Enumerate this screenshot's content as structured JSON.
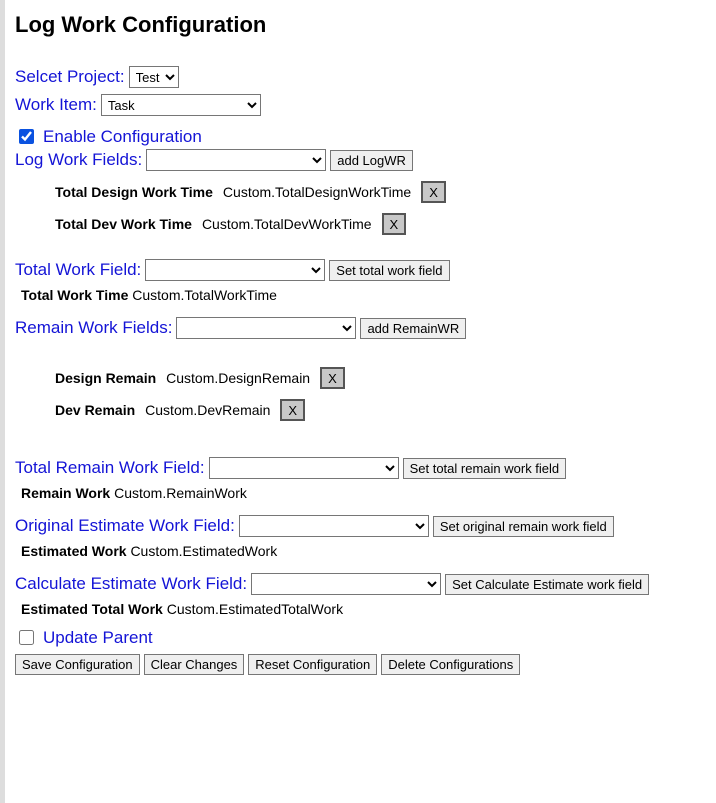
{
  "title": "Log Work Configuration",
  "project": {
    "label": "Selcet Project:",
    "value": "Test"
  },
  "workItem": {
    "label": "Work Item:",
    "value": "Task"
  },
  "enable": {
    "label": "Enable Configuration",
    "checked": true
  },
  "logWork": {
    "label": "Log Work Fields:",
    "addBtn": "add LogWR",
    "items": [
      {
        "name": "Total Design Work Time",
        "value": "Custom.TotalDesignWorkTime",
        "x": "X"
      },
      {
        "name": "Total Dev Work Time",
        "value": "Custom.TotalDevWorkTime",
        "x": "X"
      }
    ]
  },
  "totalWork": {
    "label": "Total Work Field:",
    "setBtn": "Set total work field",
    "sub": {
      "name": "Total Work Time",
      "value": "Custom.TotalWorkTime"
    }
  },
  "remainWork": {
    "label": "Remain Work Fields:",
    "addBtn": "add RemainWR",
    "items": [
      {
        "name": "Design Remain",
        "value": "Custom.DesignRemain",
        "x": "X"
      },
      {
        "name": "Dev Remain",
        "value": "Custom.DevRemain",
        "x": "X"
      }
    ]
  },
  "totalRemain": {
    "label": "Total Remain Work Field:",
    "setBtn": "Set total remain work field",
    "sub": {
      "name": "Remain Work",
      "value": "Custom.RemainWork"
    }
  },
  "originalEstimate": {
    "label": "Original Estimate Work Field:",
    "setBtn": "Set original remain work field",
    "sub": {
      "name": "Estimated Work",
      "value": "Custom.EstimatedWork"
    }
  },
  "calcEstimate": {
    "label": "Calculate Estimate Work Field:",
    "setBtn": "Set Calculate Estimate work field",
    "sub": {
      "name": "Estimated Total Work",
      "value": "Custom.EstimatedTotalWork"
    }
  },
  "updateParent": {
    "label": "Update Parent",
    "checked": false
  },
  "buttons": {
    "save": "Save Configuration",
    "clear": "Clear Changes",
    "reset": "Reset Configuration",
    "del": "Delete Configurations"
  }
}
